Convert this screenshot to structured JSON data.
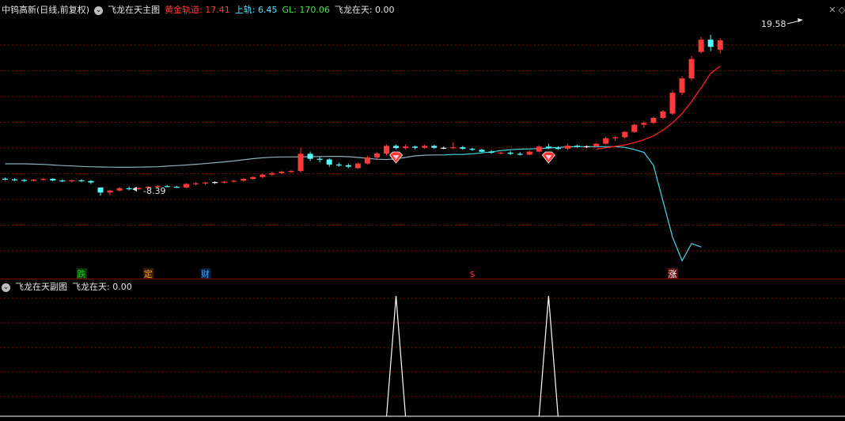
{
  "main_panel": {
    "stock_title": "中钨高新(日线,前复权)",
    "indicator_name": "飞龙在天主图",
    "gold_track": "黄金轨道: 17.41",
    "upper_track": "上轨: 6.45",
    "gl": "GL: 170.06",
    "flying_dragon": "飞龙在天: 0.00",
    "high_label": "19.58",
    "low_label": "8.39",
    "signal_markers": [
      {
        "text": "跌",
        "color": "#1fc71f",
        "bg": "#0b3a0b",
        "index": 8
      },
      {
        "text": "定",
        "color": "#ff9a2e",
        "bg": "#3a1e05",
        "index": 15
      },
      {
        "text": "财",
        "color": "#4aa8ff",
        "bg": "#061a3a",
        "index": 21
      },
      {
        "text": "$",
        "color": "#ff3030",
        "bg": "#000000",
        "index": 49
      },
      {
        "text": "涨",
        "color": "#ffffff",
        "bg": "#5a1010",
        "index": 70
      }
    ],
    "gem_indices": [
      41,
      57
    ]
  },
  "sub_panel": {
    "indicator_name": "飞龙在天副图",
    "flying_dragon": "飞龙在天: 0.00",
    "spike_indices": [
      41,
      57
    ]
  },
  "colors": {
    "up": "#ff3a3a",
    "down": "#54ffff",
    "doji": "#ffffff",
    "upper_line": "#4ad6e6",
    "upper_line_left": "#8cb0b8",
    "gold_line": "#ff2020",
    "grid": "#8a0000"
  },
  "chart_data": {
    "type": "candlestick",
    "price_range": [
      3.6,
      20.8
    ],
    "candles": [
      [
        9.57,
        9.64,
        9.45,
        9.52
      ],
      [
        9.52,
        9.6,
        9.4,
        9.48
      ],
      [
        9.48,
        9.53,
        9.35,
        9.42
      ],
      [
        9.42,
        9.55,
        9.38,
        9.5
      ],
      [
        9.5,
        9.62,
        9.45,
        9.55
      ],
      [
        9.55,
        9.6,
        9.38,
        9.44
      ],
      [
        9.44,
        9.52,
        9.32,
        9.39
      ],
      [
        9.39,
        9.5,
        9.3,
        9.45
      ],
      [
        9.45,
        9.52,
        9.33,
        9.4
      ],
      [
        9.4,
        9.48,
        9.2,
        9.3
      ],
      [
        8.95,
        8.95,
        8.39,
        8.6
      ],
      [
        8.6,
        8.8,
        8.42,
        8.74
      ],
      [
        8.74,
        8.98,
        8.68,
        8.9
      ],
      [
        8.9,
        9.02,
        8.75,
        8.83
      ],
      [
        8.83,
        8.96,
        8.76,
        8.92
      ],
      [
        8.92,
        9.07,
        8.86,
        9.0
      ],
      [
        9.0,
        9.12,
        8.9,
        9.05
      ],
      [
        9.05,
        9.12,
        8.96,
        9.0
      ],
      [
        9.0,
        9.07,
        8.92,
        8.95
      ],
      [
        8.95,
        9.25,
        8.9,
        9.2
      ],
      [
        9.2,
        9.32,
        9.1,
        9.25
      ],
      [
        9.25,
        9.34,
        9.15,
        9.3
      ],
      [
        9.3,
        9.38,
        9.2,
        9.33
      ],
      [
        9.3,
        9.4,
        9.22,
        9.36
      ],
      [
        9.36,
        9.48,
        9.3,
        9.42
      ],
      [
        9.42,
        9.6,
        9.36,
        9.55
      ],
      [
        9.55,
        9.74,
        9.48,
        9.68
      ],
      [
        9.68,
        9.92,
        9.6,
        9.85
      ],
      [
        9.85,
        10.05,
        9.75,
        9.95
      ],
      [
        9.95,
        10.12,
        9.88,
        10.05
      ],
      [
        10.05,
        10.16,
        9.96,
        10.1
      ],
      [
        10.1,
        11.7,
        10.0,
        11.3
      ],
      [
        11.3,
        11.45,
        10.8,
        10.95
      ],
      [
        10.95,
        11.1,
        10.7,
        10.9
      ],
      [
        10.9,
        10.98,
        10.4,
        10.55
      ],
      [
        10.55,
        10.68,
        10.4,
        10.5
      ],
      [
        10.5,
        10.62,
        10.3,
        10.4
      ],
      [
        10.3,
        10.68,
        10.25,
        10.62
      ],
      [
        10.62,
        11.15,
        10.55,
        11.05
      ],
      [
        11.05,
        11.4,
        10.95,
        11.32
      ],
      [
        11.32,
        11.95,
        11.2,
        11.85
      ],
      [
        11.85,
        11.95,
        11.6,
        11.7
      ],
      [
        11.7,
        11.95,
        11.6,
        11.8
      ],
      [
        11.8,
        11.88,
        11.6,
        11.72
      ],
      [
        11.72,
        11.95,
        11.65,
        11.85
      ],
      [
        11.85,
        11.92,
        11.65,
        11.72
      ],
      [
        11.72,
        11.8,
        11.62,
        11.7
      ],
      [
        11.7,
        12.1,
        11.6,
        11.75
      ],
      [
        11.75,
        11.85,
        11.58,
        11.65
      ],
      [
        11.65,
        11.72,
        11.5,
        11.58
      ],
      [
        11.58,
        11.64,
        11.4,
        11.44
      ],
      [
        11.44,
        11.55,
        11.3,
        11.38
      ],
      [
        11.32,
        11.45,
        11.25,
        11.38
      ],
      [
        11.38,
        11.5,
        11.2,
        11.3
      ],
      [
        11.3,
        11.42,
        11.18,
        11.24
      ],
      [
        11.24,
        11.55,
        11.2,
        11.45
      ],
      [
        11.45,
        11.9,
        11.4,
        11.8
      ],
      [
        11.8,
        12.0,
        11.62,
        11.7
      ],
      [
        11.7,
        11.82,
        11.58,
        11.66
      ],
      [
        11.66,
        12.0,
        11.55,
        11.86
      ],
      [
        11.86,
        11.92,
        11.72,
        11.8
      ],
      [
        11.8,
        11.88,
        11.7,
        11.82
      ],
      [
        11.82,
        12.05,
        11.76,
        12.0
      ],
      [
        12.0,
        12.48,
        11.95,
        12.38
      ],
      [
        12.38,
        12.55,
        12.2,
        12.45
      ],
      [
        12.45,
        12.9,
        12.36,
        12.82
      ],
      [
        12.82,
        13.4,
        12.75,
        13.32
      ],
      [
        13.32,
        13.55,
        13.1,
        13.45
      ],
      [
        13.45,
        13.9,
        13.38,
        13.8
      ],
      [
        13.8,
        14.35,
        13.7,
        14.25
      ],
      [
        14.1,
        15.7,
        14.0,
        15.55
      ],
      [
        15.55,
        16.7,
        15.4,
        16.55
      ],
      [
        16.55,
        18.1,
        16.4,
        17.9
      ],
      [
        18.4,
        19.45,
        18.3,
        19.25
      ],
      [
        19.25,
        19.58,
        18.45,
        18.75
      ],
      [
        18.55,
        19.35,
        18.3,
        19.2
      ]
    ],
    "upper_track": [
      10.6,
      10.6,
      10.6,
      10.58,
      10.56,
      10.52,
      10.48,
      10.45,
      10.42,
      10.4,
      10.38,
      10.37,
      10.36,
      10.36,
      10.37,
      10.38,
      10.4,
      10.44,
      10.48,
      10.52,
      10.57,
      10.62,
      10.68,
      10.74,
      10.8,
      10.88,
      10.96,
      11.02,
      11.06,
      11.08,
      11.08,
      11.09,
      11.1,
      11.11,
      11.12,
      11.12,
      11.1,
      11.05,
      10.98,
      10.92,
      10.9,
      10.95,
      11.05,
      11.15,
      11.2,
      11.22,
      11.22,
      11.25,
      11.26,
      11.3,
      11.36,
      11.44,
      11.52,
      11.58,
      11.62,
      11.64,
      11.66,
      11.7,
      11.74,
      11.78,
      11.8,
      11.8,
      11.8,
      11.8,
      11.8,
      11.75,
      11.6,
      11.4,
      10.5,
      8.0,
      5.5,
      3.85,
      5.05,
      4.8
    ],
    "upper_track_start_index": 0,
    "gold_track": [
      11.62,
      11.72,
      11.82,
      11.92,
      12.08,
      12.28,
      12.55,
      12.95,
      13.45,
      14.1,
      14.95,
      15.9,
      16.9,
      17.41
    ],
    "gold_track_start_index": 62,
    "sub_indicator": {
      "type": "spike",
      "indices": [
        41,
        57
      ],
      "value": 1
    }
  }
}
